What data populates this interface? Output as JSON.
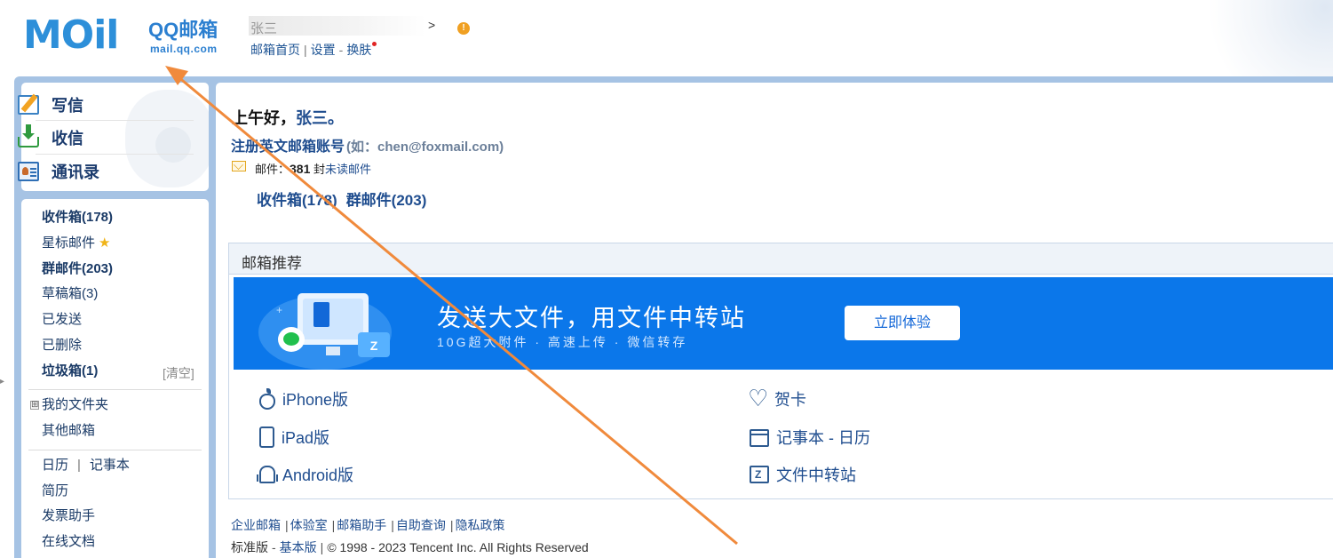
{
  "header": {
    "logo_word": "MOil",
    "logo_title": "QQ邮箱",
    "logo_domain": "mail.qq.com",
    "user_name_blurred": "张三",
    "user_chevron": ">",
    "warning_glyph": "!",
    "nav": {
      "home": "邮箱首页",
      "settings": "设置",
      "skin": "换肤",
      "sep1": "|",
      "sep2": "-"
    }
  },
  "sidebar": {
    "actions": [
      {
        "label": "写信",
        "icon": "compose-icon"
      },
      {
        "label": "收信",
        "icon": "inbox-download-icon"
      },
      {
        "label": "通讯录",
        "icon": "address-book-icon"
      }
    ],
    "folders": {
      "inbox": "收件箱(178)",
      "starred": "星标邮件",
      "group": "群邮件(203)",
      "drafts": "草稿箱(3)",
      "sent": "已发送",
      "deleted": "已删除",
      "spam": "垃圾箱(1)",
      "spam_clear": "[清空]",
      "my_folders": "我的文件夹",
      "my_folders_toggle": "⊞",
      "other_mailboxes": "其他邮箱",
      "calendar": "日历",
      "calendar_sep": "|",
      "notes": "记事本",
      "resume": "简历",
      "invoice": "发票助手",
      "online_docs": "在线文档"
    }
  },
  "main": {
    "greeting_prefix": "上午好，",
    "greeting_name": "张三。",
    "register_link": "注册英文邮箱账号",
    "register_example": "(如：chen@foxmail.com)",
    "unread_prefix": "邮件：",
    "unread_count": "381",
    "unread_unit": "封",
    "unread_link": "未读邮件",
    "inbox_link": "收件箱(178)",
    "group_link": "群邮件(203)"
  },
  "recommend": {
    "title": "邮箱推荐",
    "banner_title": "发送大文件，用文件中转站",
    "banner_subtitle": "10G超大附件 · 高速上传 · 微信转存",
    "banner_button": "立即体验",
    "banner_folder_glyph": "Z",
    "apps": [
      {
        "label": "iPhone版",
        "icon": "apple-icon"
      },
      {
        "label": "iPad版",
        "icon": "ipad-icon"
      },
      {
        "label": "Android版",
        "icon": "android-icon"
      },
      {
        "label": "贺卡",
        "icon": "heart-icon"
      },
      {
        "label": "记事本 - 日历",
        "icon": "calendar-icon"
      },
      {
        "label": "文件中转站",
        "icon": "file-transfer-icon"
      }
    ]
  },
  "footer": {
    "links": [
      "企业邮箱",
      "体验室",
      "邮箱助手",
      "自助查询",
      "隐私政策"
    ],
    "link_sep": "|",
    "version_standard": "标准版",
    "version_sep": "-",
    "version_basic": "基本版",
    "copy_sep": "|",
    "copyright": "© 1998 - 2023 Tencent Inc. All Rights Reserved"
  },
  "colors": {
    "brand_blue": "#2d8fd9",
    "frame_blue": "#a6c3e4",
    "link_blue": "#1f4d8f",
    "banner_blue": "#0b77ea",
    "annotation_arrow": "#f08a3c",
    "skin_dot": "#e02424"
  }
}
